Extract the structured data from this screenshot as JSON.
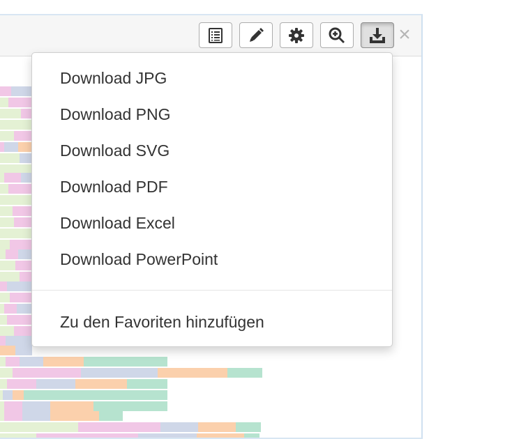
{
  "toolbar": {
    "buttons": [
      {
        "name": "table-view-button",
        "icon": "list-icon"
      },
      {
        "name": "edit-button",
        "icon": "pencil-icon"
      },
      {
        "name": "settings-button",
        "icon": "gear-icon"
      },
      {
        "name": "zoom-button",
        "icon": "zoom-in-icon"
      },
      {
        "name": "download-button",
        "icon": "download-icon",
        "active": true
      }
    ],
    "close_label": "×"
  },
  "dropdown": {
    "items": [
      {
        "label": "Download JPG"
      },
      {
        "label": "Download PNG"
      },
      {
        "label": "Download SVG"
      },
      {
        "label": "Download PDF"
      },
      {
        "label": "Download Excel"
      },
      {
        "label": "Download PowerPoint"
      }
    ],
    "favorites_label": "Zu den Favoriten hinzufügen"
  },
  "colors": {
    "green": "#e4f1d4",
    "pink": "#f1c7e6",
    "blue": "#cfd7e8",
    "orange": "#fbd0ac",
    "teal": "#b6e3cf"
  }
}
